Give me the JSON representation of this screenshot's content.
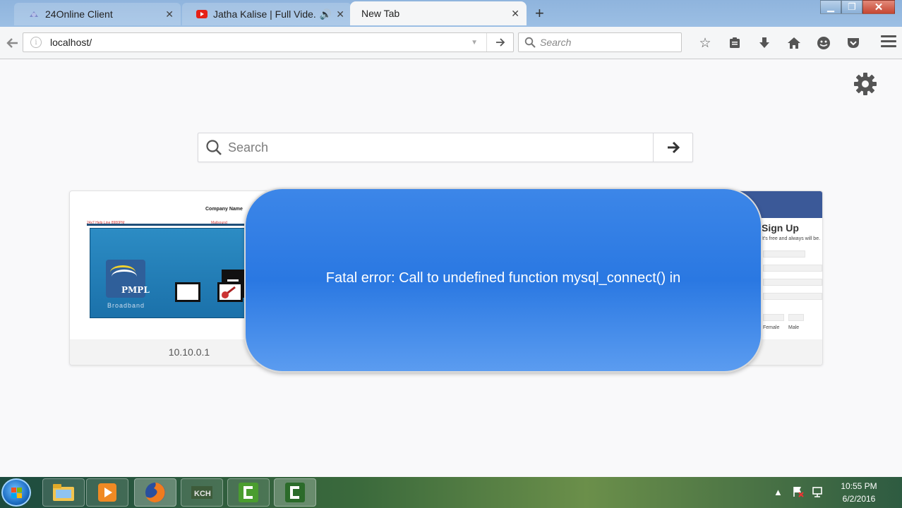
{
  "browser": {
    "tabs": [
      {
        "label": "24Online Client",
        "active": false,
        "icon": "globe-icon"
      },
      {
        "label": "Jatha Kalise | Full Vide...",
        "active": false,
        "icon": "youtube-icon",
        "audio": true
      },
      {
        "label": "New Tab",
        "active": true
      }
    ],
    "url": "localhost/",
    "search_placeholder": "Search"
  },
  "page": {
    "search_placeholder": "Search",
    "tiles": [
      {
        "caption": "10.10.0.1",
        "thumb_title": "Company Name",
        "thumb_left_text": "24x7 Help Line 8980PM",
        "thumb_mid_text": "Mailsound",
        "logo_text": "PMPL",
        "logo_sub": "Broadband"
      },
      {
        "caption": "",
        "thumb_heading": "Sign Up",
        "thumb_sub": "It's free and always will be.",
        "thumb_gender_female": "Female",
        "thumb_gender_male": "Male"
      }
    ]
  },
  "overlay": {
    "message": "Fatal error: Call to undefined function mysql_connect() in"
  },
  "taskbar": {
    "time": "10:55 PM",
    "date": "6/2/2016",
    "pinned": [
      "explorer-icon",
      "media-player-icon",
      "firefox-icon",
      "xampp-icon",
      "camtasia-icon",
      "camtasia-recorder-icon"
    ]
  },
  "colors": {
    "overlay_blue": "#2a78e2",
    "tabstrip": "#9cbfe4",
    "taskbar": "#3b6a3c"
  }
}
